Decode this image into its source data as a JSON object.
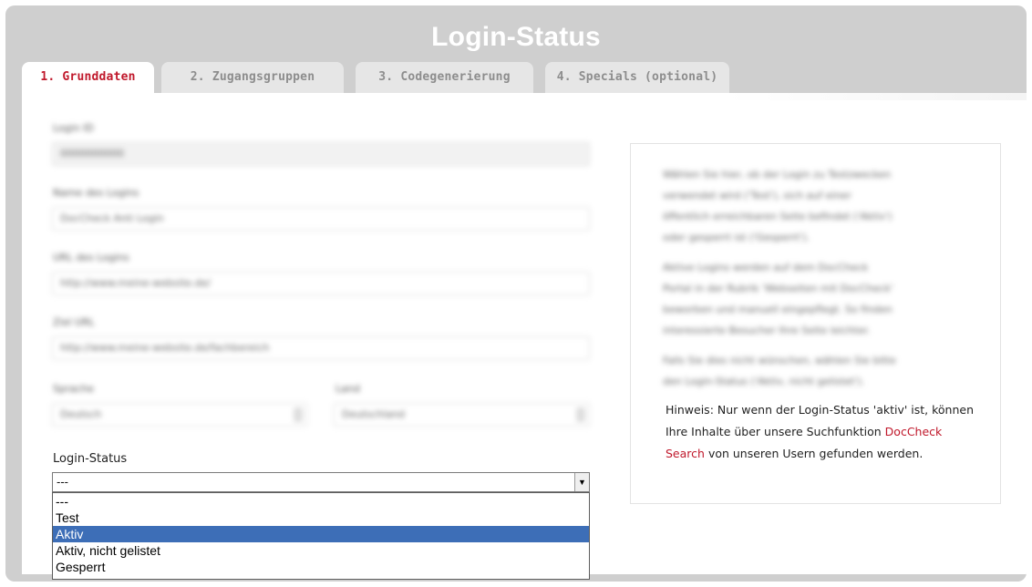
{
  "header": {
    "title": "Login-Status"
  },
  "tabs": [
    {
      "label": "1. Grunddaten",
      "active": true
    },
    {
      "label": "2. Zugangsgruppen",
      "active": false
    },
    {
      "label": "3. Codegenerierung",
      "active": false
    },
    {
      "label": "4. Specials (optional)",
      "active": false
    }
  ],
  "form": {
    "fields": [
      {
        "label": "Login ID",
        "value": "0000000000"
      },
      {
        "label": "Name des Logins",
        "value": "DocCheck Anti Login"
      },
      {
        "label": "URL des Logins",
        "value": "http://www.meine-website.de/"
      },
      {
        "label": "Ziel URL",
        "value": "http://www.meine-website.de/fachbereich"
      },
      {
        "label": "Sprache",
        "value": "Deutsch"
      },
      {
        "label": "Land",
        "value": "Deutschland"
      }
    ],
    "status": {
      "label": "Login-Status",
      "value": "---",
      "options": [
        "---",
        "Test",
        "Aktiv",
        "Aktiv, nicht gelistet",
        "Gesperrt"
      ],
      "highlighted": "Aktiv"
    }
  },
  "info": {
    "blurred_lines": [
      "Wählen Sie hier, ob der Login zu Testzwecken",
      "verwendet wird ('Test'), sich auf einer",
      "öffentlich erreichbaren Seite befindet ('Aktiv')",
      "oder gesperrt ist ('Gesperrt').",
      "Aktive Logins werden auf dem DocCheck",
      "Portal in der Rubrik 'Webseiten mit DocCheck'",
      "beworben und manuell eingepflegt. So finden",
      "interessierte Besucher Ihre Seite leichter.",
      "Falls Sie dies nicht wünschen, wählen Sie bitte",
      "den Login-Status ('Aktiv, nicht gelistet')."
    ],
    "hint_prefix": "Hinweis: Nur wenn der Login-Status 'aktiv' ist, können Ihre Inhalte über unsere Suchfunktion",
    "hint_link": "DocCheck Search",
    "hint_suffix": "von unseren Usern gefunden werden."
  }
}
